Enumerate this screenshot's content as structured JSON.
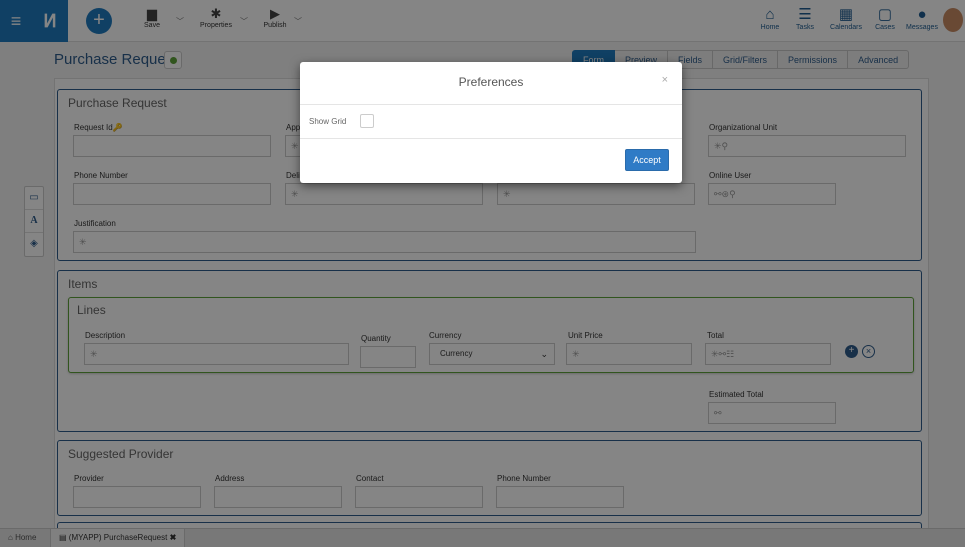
{
  "toolbar": {
    "menu_icon": "hamburger-icon",
    "save_label": "Save",
    "properties_label": "Properties",
    "publish_label": "Publish"
  },
  "nav": {
    "home": "Home",
    "tasks": "Tasks",
    "calendars": "Calendars",
    "cases": "Cases",
    "messages": "Messages"
  },
  "page": {
    "title": "Purchase Request"
  },
  "tabs": [
    "Form",
    "Preview",
    "Fields",
    "Grid/Filters",
    "Permissions",
    "Advanced"
  ],
  "side_tools": [
    "laptop-icon",
    "text-icon",
    "cube-icon"
  ],
  "form": {
    "purchase_panel_title": "Purchase Request",
    "request_id_label": "Request Id",
    "approver_label": "Appr",
    "org_unit_label": "Organizational Unit",
    "phone_label": "Phone Number",
    "delivery_label": "Deliv",
    "online_user_label": "Online User",
    "justification_label": "Justification",
    "items_panel_title": "Items",
    "lines_panel_title": "Lines",
    "description_label": "Description",
    "quantity_label": "Quantity",
    "currency_label": "Currency",
    "currency_value": "Currency",
    "unit_price_label": "Unit Price",
    "total_label": "Total",
    "estimated_total_label": "Estimated Total",
    "provider_panel_title": "Suggested Provider",
    "provider_label": "Provider",
    "address_label": "Address",
    "contact_label": "Contact",
    "provider_phone_label": "Phone Number"
  },
  "footer": {
    "home": "Home",
    "tab": "(MYAPP) PurchaseRequest"
  },
  "modal": {
    "title": "Preferences",
    "close": "×",
    "show_grid_label": "Show Grid",
    "show_grid_checked": false,
    "accept_label": "Accept"
  },
  "colors": {
    "accent": "#1f7bc0",
    "panel_border": "#2f5d8c",
    "lines_border": "#5fa33a"
  }
}
